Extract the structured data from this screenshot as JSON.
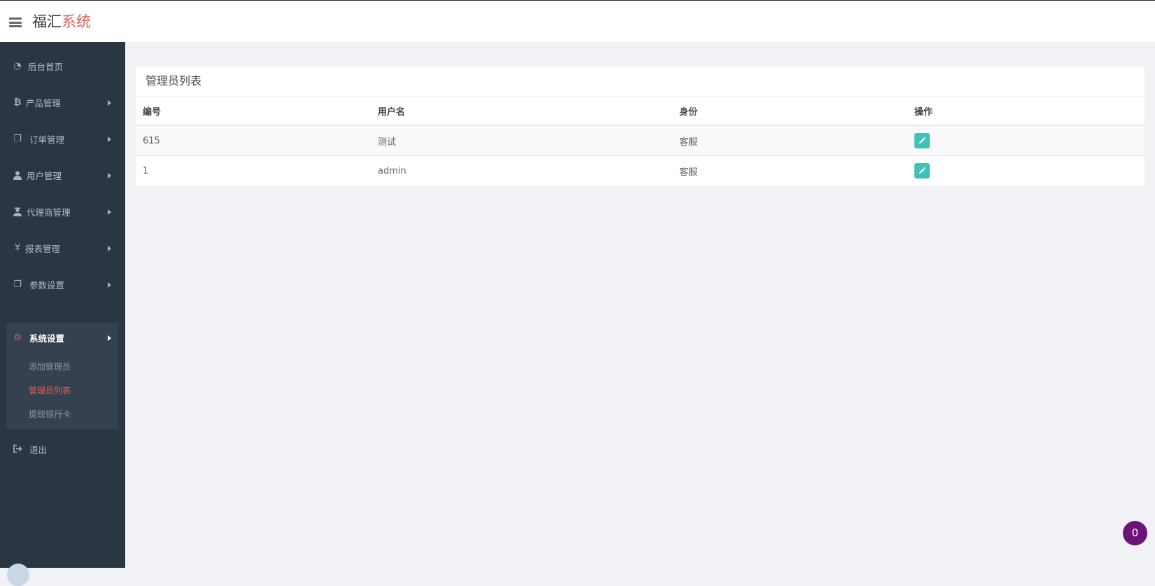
{
  "header": {
    "brand_part1": "福汇",
    "brand_part2": "系统",
    "brand_accent_color": "#e05d4f"
  },
  "sidebar": {
    "items": [
      {
        "label": "后台首页",
        "icon": "dashboard-icon"
      },
      {
        "label": "产品管理",
        "icon": "bitcoin-icon"
      },
      {
        "label": "订单管理",
        "icon": "copy-icon"
      },
      {
        "label": "用户管理",
        "icon": "user-icon"
      },
      {
        "label": "代理商管理",
        "icon": "user-secret-icon"
      },
      {
        "label": "报表管理",
        "icon": "yen-icon"
      },
      {
        "label": "参数设置",
        "icon": "copy-icon"
      },
      {
        "label": "系统设置",
        "icon": "gears-icon",
        "active": true
      },
      {
        "label": "退出",
        "icon": "sign-out-icon"
      }
    ],
    "submenu": [
      {
        "label": "添加管理员"
      },
      {
        "label": "管理员列表",
        "current": true
      },
      {
        "label": "提现银行卡"
      }
    ]
  },
  "main": {
    "panel_title": "管理员列表",
    "table": {
      "headers": [
        "编号",
        "用户名",
        "身份",
        "操作"
      ],
      "rows": [
        {
          "id": "615",
          "username": "测试",
          "role": "客服"
        },
        {
          "id": "1",
          "username": "admin",
          "role": "客服"
        }
      ]
    }
  },
  "notification": {
    "count": "0"
  }
}
